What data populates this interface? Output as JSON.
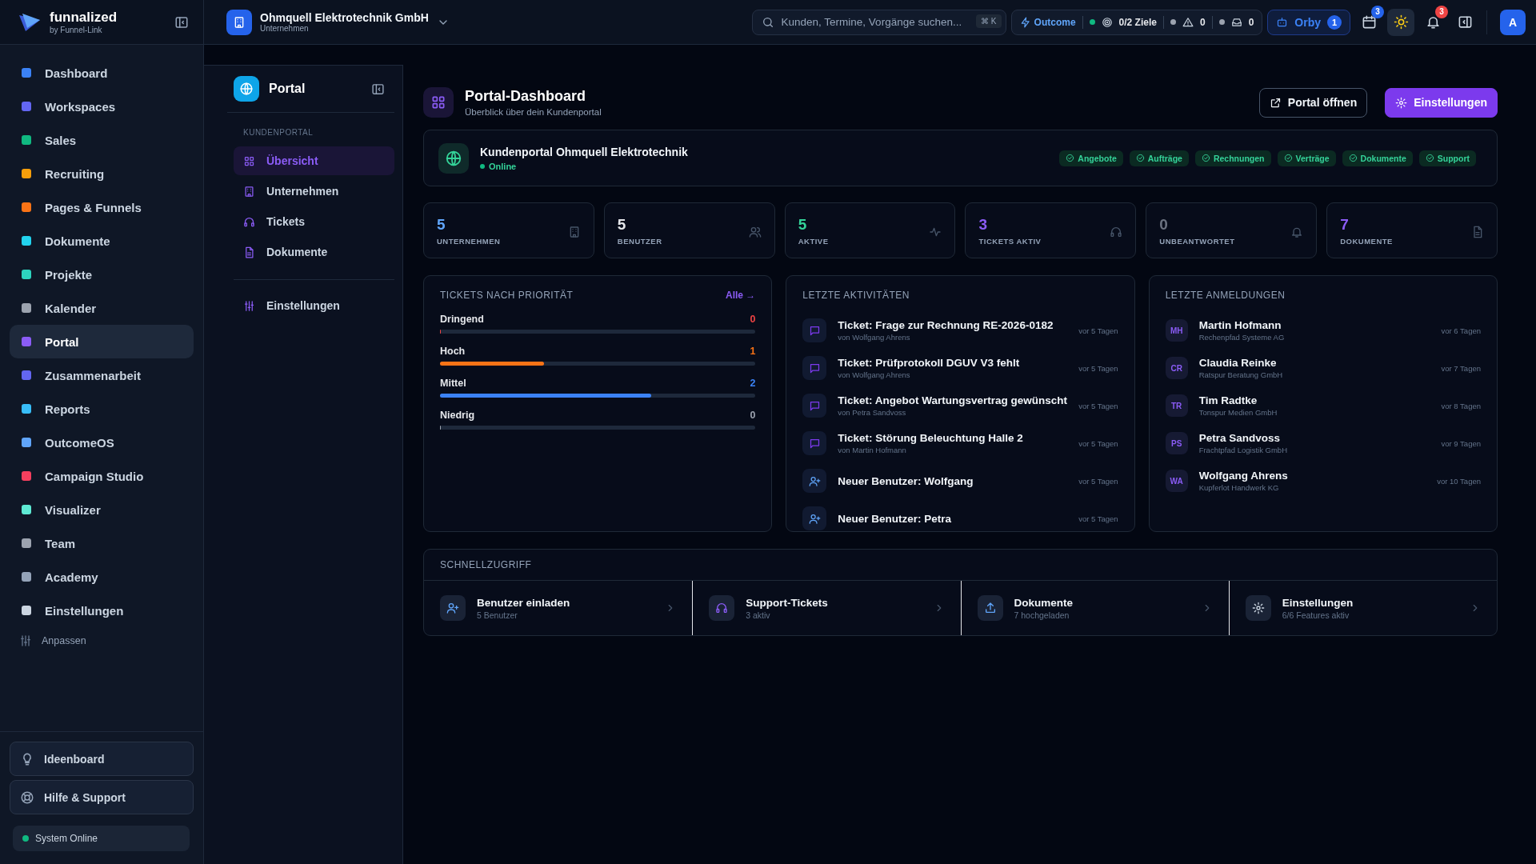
{
  "brand": {
    "name": "funnalized",
    "tagline": "by Funnel-Link"
  },
  "company": {
    "name": "Ohmquell Elektrotechnik GmbH",
    "type": "Unternehmen"
  },
  "search": {
    "placeholder": "Kunden, Termine, Vorgänge suchen...",
    "shortcut": "⌘ K"
  },
  "status": {
    "outcome": "Outcome",
    "goals": "0/2 Ziele",
    "alerts": "0",
    "inbox": "0"
  },
  "orby": {
    "label": "Orby",
    "count": "1"
  },
  "calendar_badge": "3",
  "notifications_badge": "3",
  "avatar": "A",
  "sidebar": {
    "items": [
      {
        "label": "Dashboard",
        "selected": false,
        "color": "#3b82f6"
      },
      {
        "label": "Workspaces",
        "selected": false,
        "color": "#6366f1"
      },
      {
        "label": "Sales",
        "selected": false,
        "color": "#10b981"
      },
      {
        "label": "Recruiting",
        "selected": false,
        "color": "#f59e0b"
      },
      {
        "label": "Pages & Funnels",
        "selected": false,
        "color": "#f97316"
      },
      {
        "label": "Dokumente",
        "selected": false,
        "color": "#22d3ee"
      },
      {
        "label": "Projekte",
        "selected": false,
        "color": "#2dd4bf"
      },
      {
        "label": "Kalender",
        "selected": false,
        "color": "#9ca3af"
      },
      {
        "label": "Portal",
        "selected": true,
        "color": "#8b5cf6"
      },
      {
        "label": "Zusammenarbeit",
        "selected": false,
        "color": "#6366f1"
      },
      {
        "label": "Reports",
        "selected": false,
        "color": "#38bdf8"
      },
      {
        "label": "OutcomeOS",
        "selected": false,
        "color": "#60a5fa"
      },
      {
        "label": "Campaign Studio",
        "selected": false,
        "color": "#f43f5e"
      },
      {
        "label": "Visualizer",
        "selected": false,
        "color": "#5eead4"
      },
      {
        "label": "Team",
        "selected": false,
        "color": "#9ca3af"
      },
      {
        "label": "Academy",
        "selected": false,
        "color": "#94a3b8"
      },
      {
        "label": "Einstellungen",
        "selected": false,
        "color": "#cbd5e1"
      }
    ],
    "customize": "Anpassen",
    "bottom": [
      "Ideenboard",
      "Hilfe & Support"
    ],
    "system_status": "System Online"
  },
  "subnav": {
    "title": "Portal",
    "section": "KUNDENPORTAL",
    "items": [
      {
        "label": "Übersicht",
        "selected": true
      },
      {
        "label": "Unternehmen",
        "selected": false
      },
      {
        "label": "Tickets",
        "selected": false
      },
      {
        "label": "Dokumente",
        "selected": false
      }
    ],
    "settings": "Einstellungen"
  },
  "header": {
    "title": "Portal-Dashboard",
    "subtitle": "Überblick über dein Kundenportal",
    "buttons": [
      {
        "label": "Portal öffnen",
        "kind": "secondary"
      },
      {
        "label": "Einstellungen",
        "kind": "primary"
      }
    ]
  },
  "portal": {
    "name": "Kundenportal Ohmquell Elektrotechnik",
    "status": "Online",
    "features": [
      "Angebote",
      "Aufträge",
      "Rechnungen",
      "Verträge",
      "Dokumente",
      "Support"
    ]
  },
  "stats": [
    {
      "value": "5",
      "label": "UNTERNEHMEN",
      "color": "#60a5fa"
    },
    {
      "value": "5",
      "label": "BENUTZER",
      "color": "#e5e7eb"
    },
    {
      "value": "5",
      "label": "AKTIVE",
      "color": "#34d399"
    },
    {
      "value": "3",
      "label": "TICKETS AKTIV",
      "color": "#8b5cf6"
    },
    {
      "value": "0",
      "label": "UNBEANTWORTET",
      "color": "#6b7280"
    },
    {
      "value": "7",
      "label": "DOKUMENTE",
      "color": "#8b5cf6"
    }
  ],
  "priorities": {
    "title": "TICKETS NACH PRIORITÄT",
    "link": "Alle →",
    "items": [
      {
        "label": "Dringend",
        "count": "0",
        "level": 0,
        "color": "#ef4444"
      },
      {
        "label": "Hoch",
        "count": "1",
        "level": 0.33,
        "color": "#f97316"
      },
      {
        "label": "Mittel",
        "count": "2",
        "level": 0.67,
        "color": "#3b82f6"
      },
      {
        "label": "Niedrig",
        "count": "0",
        "level": 0,
        "color": "#9ca3af"
      }
    ]
  },
  "activities": {
    "title": "LETZTE AKTIVITÄTEN",
    "items": [
      {
        "kind": "ticket",
        "title": "Ticket: Frage zur Rechnung RE-2026-0182",
        "by": "von Wolfgang Ahrens",
        "time": "vor 5 Tagen"
      },
      {
        "kind": "ticket",
        "title": "Ticket: Prüfprotokoll DGUV V3 fehlt",
        "by": "von Wolfgang Ahrens",
        "time": "vor 5 Tagen"
      },
      {
        "kind": "ticket",
        "title": "Ticket: Angebot Wartungsvertrag gewünscht",
        "by": "von Petra Sandvoss",
        "time": "vor 5 Tagen"
      },
      {
        "kind": "ticket",
        "title": "Ticket: Störung Beleuchtung Halle 2",
        "by": "von Martin Hofmann",
        "time": "vor 5 Tagen"
      },
      {
        "kind": "user",
        "title": "Neuer Benutzer: Wolfgang",
        "time": "vor 5 Tagen"
      },
      {
        "kind": "user",
        "title": "Neuer Benutzer: Petra",
        "time": "vor 5 Tagen"
      }
    ]
  },
  "logins": {
    "title": "LETZTE ANMELDUNGEN",
    "items": [
      {
        "initials": "MH",
        "name": "Martin Hofmann",
        "company": "Rechenpfad Systeme AG",
        "time": "vor 6 Tagen"
      },
      {
        "initials": "CR",
        "name": "Claudia Reinke",
        "company": "Ratspur Beratung GmbH",
        "time": "vor 7 Tagen"
      },
      {
        "initials": "TR",
        "name": "Tim Radtke",
        "company": "Tonspur Medien GmbH",
        "time": "vor 8 Tagen"
      },
      {
        "initials": "PS",
        "name": "Petra Sandvoss",
        "company": "Frachtpfad Logistik GmbH",
        "time": "vor 9 Tagen"
      },
      {
        "initials": "WA",
        "name": "Wolfgang Ahrens",
        "company": "Kupferlot Handwerk KG",
        "time": "vor 10 Tagen"
      }
    ]
  },
  "quick_access": {
    "title": "SCHNELLZUGRIFF",
    "items": [
      {
        "kind": "invite",
        "title": "Benutzer einladen",
        "subtitle": "5 Benutzer"
      },
      {
        "kind": "support",
        "title": "Support-Tickets",
        "subtitle": "3 aktiv"
      },
      {
        "kind": "upload",
        "title": "Dokumente",
        "subtitle": "7 hochgeladen"
      },
      {
        "kind": "settings",
        "title": "Einstellungen",
        "subtitle": "6/6 Features aktiv"
      }
    ]
  }
}
